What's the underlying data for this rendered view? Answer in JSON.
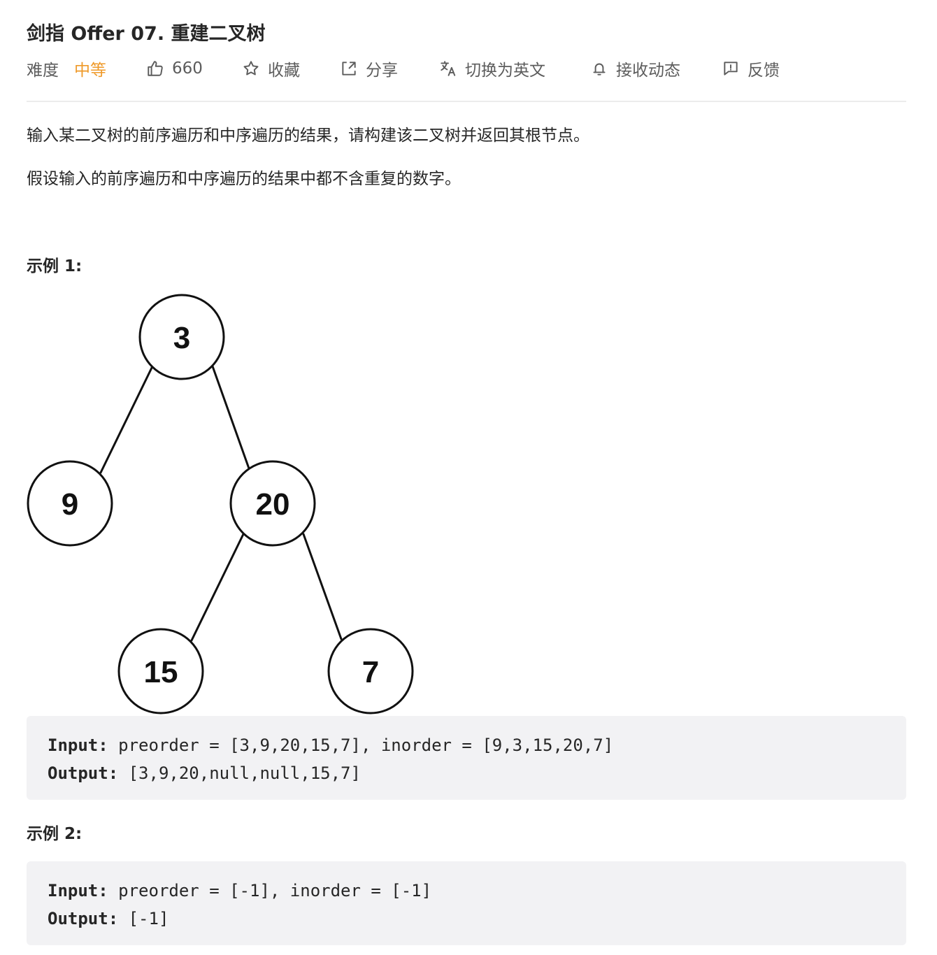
{
  "title": "剑指 Offer 07. 重建二叉树",
  "meta": {
    "difficulty_label": "难度",
    "difficulty_value": "中等",
    "likes": "660",
    "favorite": "收藏",
    "share": "分享",
    "switch_lang": "切换为英文",
    "subscribe": "接收动态",
    "feedback": "反馈",
    "colors": {
      "difficulty": "#ef9a2a",
      "text": "#5c5c5c"
    }
  },
  "description": {
    "p1": "输入某二叉树的前序遍历和中序遍历的结果，请构建该二叉树并返回其根节点。",
    "p2": "假设输入的前序遍历和中序遍历的结果中都不含重复的数字。"
  },
  "example1": {
    "title": "示例 1:",
    "tree_nodes": [
      "3",
      "9",
      "20",
      "15",
      "7"
    ],
    "input_label": "Input:",
    "input_value": "preorder = [3,9,20,15,7], inorder = [9,3,15,20,7]",
    "output_label": "Output:",
    "output_value": "[3,9,20,null,null,15,7]"
  },
  "example2": {
    "title": "示例 2:",
    "input_label": "Input:",
    "input_value": "preorder = [-1], inorder = [-1]",
    "output_label": "Output:",
    "output_value": "[-1]"
  }
}
